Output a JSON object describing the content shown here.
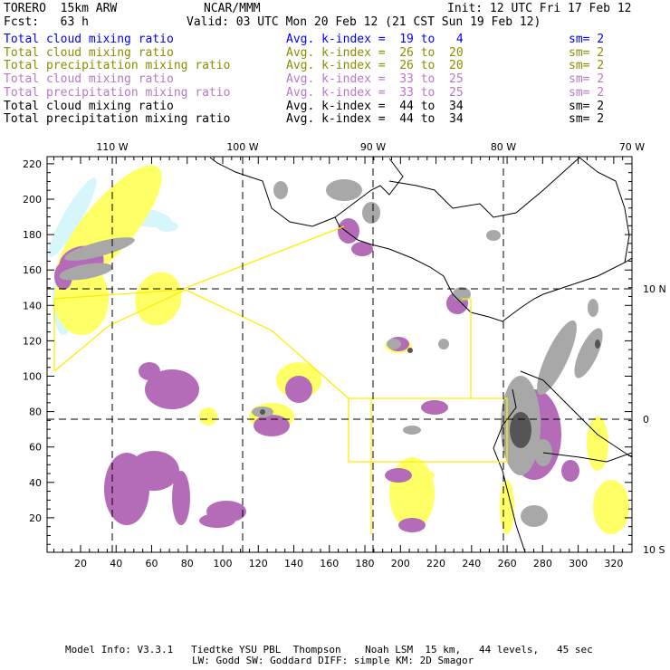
{
  "header": {
    "model": "TORERO  15km ARW",
    "org": "NCAR/MMM",
    "init": "Init: 12 UTC Fri 17 Feb 12",
    "fcst": "Fcst:   63 h",
    "valid": "Valid: 03 UTC Mon 20 Feb 12 (21 CST Sun 19 Feb 12)"
  },
  "legend": [
    {
      "field": "Total cloud mixing ratio",
      "range": "Avg. k-index =  19 to   4",
      "sm": "sm= 2",
      "color": "#0000ff"
    },
    {
      "field": "Total cloud mixing ratio",
      "range": "Avg. k-index =  26 to  20",
      "sm": "sm= 2",
      "color": "#8c8c00"
    },
    {
      "field": "Total precipitation mixing ratio",
      "range": "Avg. k-index =  26 to  20",
      "sm": "sm= 2",
      "color": "#8c8c00"
    },
    {
      "field": "Total cloud mixing ratio",
      "range": "Avg. k-index =  33 to  25",
      "sm": "sm= 2",
      "color": "#b877c8"
    },
    {
      "field": "Total precipitation mixing ratio",
      "range": "Avg. k-index =  33 to  25",
      "sm": "sm= 2",
      "color": "#b877c8"
    },
    {
      "field": "Total cloud mixing ratio",
      "range": "Avg. k-index =  44 to  34",
      "sm": "sm= 2",
      "color": "#000000"
    },
    {
      "field": "Total precipitation mixing ratio",
      "range": "Avg. k-index =  44 to  34",
      "sm": "sm= 2",
      "color": "#000000"
    }
  ],
  "map": {
    "x_ticks": [
      "20",
      "40",
      "60",
      "80",
      "100",
      "120",
      "140",
      "160",
      "180",
      "200",
      "220",
      "240",
      "260",
      "280",
      "300",
      "320"
    ],
    "y_ticks": [
      "20",
      "40",
      "60",
      "80",
      "100",
      "120",
      "140",
      "160",
      "180",
      "200",
      "220"
    ],
    "lon_labels": [
      "110 W",
      "100 W",
      "90 W",
      "80 W",
      "70 W"
    ],
    "lat_labels": [
      "10 N",
      "0",
      "10 S"
    ],
    "colors": {
      "light_blue": "#d6f6fc",
      "yellow": "#ffff66",
      "purple": "#b46cb8",
      "gray": "#a8a8a8",
      "dark_gray": "#555555"
    }
  },
  "footer": {
    "line1": "Model Info: V3.3.1   Tiedtke YSU PBL  Thompson    Noah LSM  15 km,   44 levels,   45 sec",
    "line2": "LW: Godd SW: Goddard DIFF: simple KM: 2D Smagor"
  }
}
